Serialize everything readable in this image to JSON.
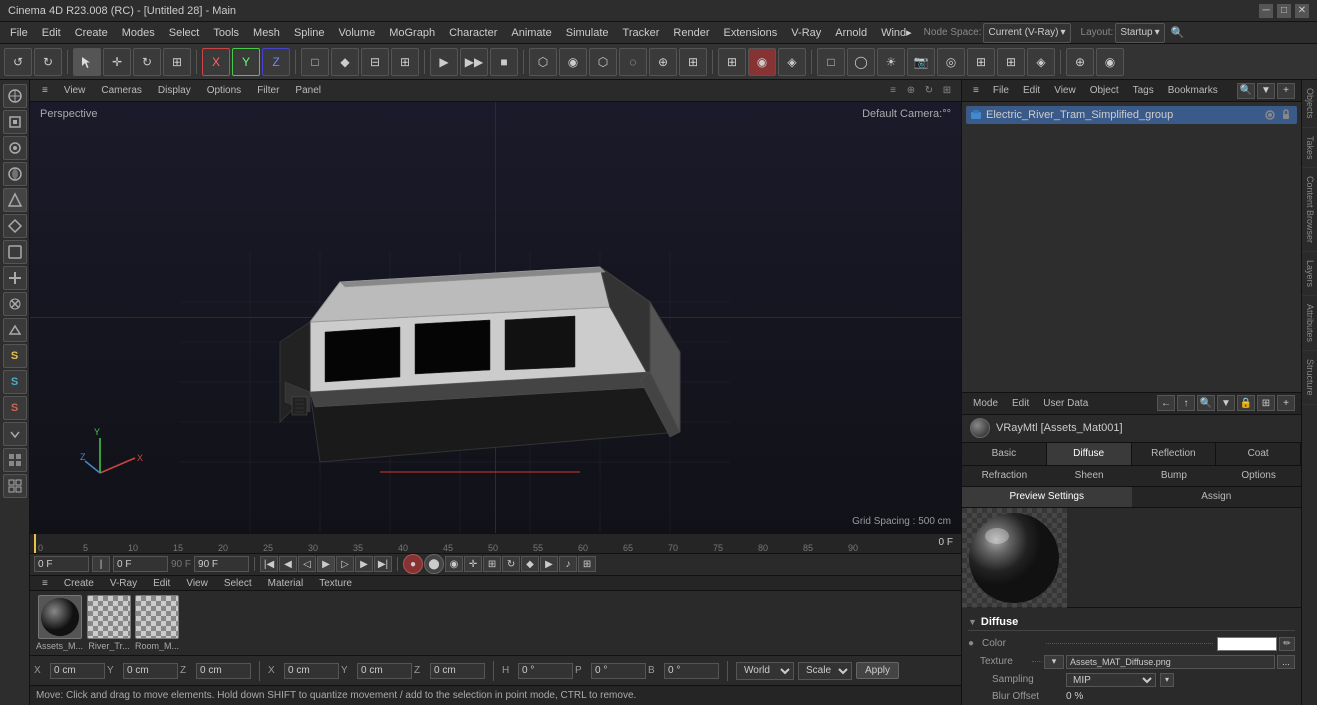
{
  "app": {
    "title": "Cinema 4D R23.008 (RC) - [Untitled 28] - Main"
  },
  "menubar": {
    "items": [
      "File",
      "Edit",
      "Create",
      "Modes",
      "Select",
      "Tools",
      "Mesh",
      "Spline",
      "Volume",
      "MoGraph",
      "Character",
      "Animate",
      "Simulate",
      "Tracker",
      "Render",
      "Extensions",
      "V-Ray",
      "Arnold",
      "Wind...",
      "Node Space:",
      "Current (V-Ray)",
      "Layout:",
      "Startup"
    ]
  },
  "toolbar": {
    "items": [
      "↺",
      "↻",
      "⊕",
      "✛",
      "↔",
      "↻",
      "⊗",
      "X",
      "Y",
      "Z",
      "□",
      "♦",
      "↻",
      "⊕",
      "▶",
      "⏸",
      "⏹",
      "⌃",
      "⊞",
      "◉",
      "⬡",
      "⬡",
      "⌘",
      "◉",
      "⌘",
      "↕",
      "◇",
      "⊞",
      "⊞",
      "⊞",
      "⊞",
      "⊞",
      "⊞",
      "⊞",
      "⊞",
      "⊞",
      "⊞",
      "⊞"
    ]
  },
  "viewport": {
    "perspective_label": "Perspective",
    "camera_label": "Default Camera:°°",
    "grid_label": "Grid Spacing : 500 cm",
    "toolbar": {
      "items": [
        "≡",
        "View",
        "Cameras",
        "Display",
        "Options",
        "Filter",
        "Panel"
      ]
    }
  },
  "timeline": {
    "ruler_marks": [
      "0",
      "5",
      "10",
      "15",
      "20",
      "25",
      "30",
      "35",
      "40",
      "45",
      "50",
      "55",
      "60",
      "65",
      "70",
      "75",
      "80",
      "85",
      "90"
    ],
    "frame_indicator": "0 F",
    "current_frame": "0 F",
    "frame_range_start": "0 F",
    "frame_range_end": "90 F",
    "frame_end2": "90 F"
  },
  "material_bar": {
    "toolbar": {
      "items": [
        "≡",
        "Create",
        "V-Ray",
        "Edit",
        "View",
        "Select",
        "Material",
        "Texture"
      ]
    },
    "materials": [
      {
        "name": "Assets_M...",
        "type": "sphere"
      },
      {
        "name": "River_Tr...",
        "type": "checker"
      },
      {
        "name": "Room_M...",
        "type": "checker"
      }
    ]
  },
  "coords": {
    "x_pos": "0 cm",
    "y_pos": "0 cm",
    "z_pos": "0 cm",
    "x_size": "0 cm",
    "y_size": "0 cm",
    "z_size": "0 cm",
    "h_rot": "0 °",
    "p_rot": "0 °",
    "b_rot": "0 °",
    "coord_system": "World",
    "scale_mode": "Scale",
    "apply_label": "Apply"
  },
  "statusbar": {
    "text": "Move: Click and drag to move elements. Hold down SHIFT to quantize movement / add to the selection in point mode, CTRL to remove."
  },
  "right_panel": {
    "top_toolbar": {
      "items": [
        "≡",
        "File",
        "Edit",
        "View",
        "Object",
        "Tags",
        "Bookmarks"
      ]
    },
    "scene_object": "Electric_River_Tram_Simplified_group",
    "mode_toolbar": {
      "items": [
        "Mode",
        "Edit",
        "User Data"
      ]
    },
    "material_name": "VRayMtl [Assets_Mat001]",
    "tabs": {
      "main": [
        "Basic",
        "Diffuse",
        "Reflection",
        "Coat",
        "Refraction",
        "Sheen",
        "Bump",
        "Options"
      ],
      "sub": [
        "Preview Settings",
        "Assign"
      ]
    },
    "active_tab": "Diffuse",
    "diffuse": {
      "section_title": "Diffuse",
      "color_label": "Color",
      "texture_label": "Texture",
      "texture_path": "Assets_MAT_Diffuse.png",
      "sampling_label": "Sampling",
      "sampling_value": "MIP",
      "blur_offset_label": "Blur Offset",
      "blur_offset_value": "0 %"
    }
  },
  "side_tabs": {
    "items": [
      "Objects",
      "Takes",
      "Content Browser",
      "Layers",
      "Attributes",
      "Structure"
    ]
  },
  "left_sidebar": {
    "tools": [
      "⊕",
      "◈",
      "⊕",
      "◉",
      "✦",
      "⬡",
      "⊙",
      "⊕",
      "✱",
      "▶",
      "S",
      "S",
      "S",
      "▼",
      "⊞",
      "⊞"
    ]
  }
}
